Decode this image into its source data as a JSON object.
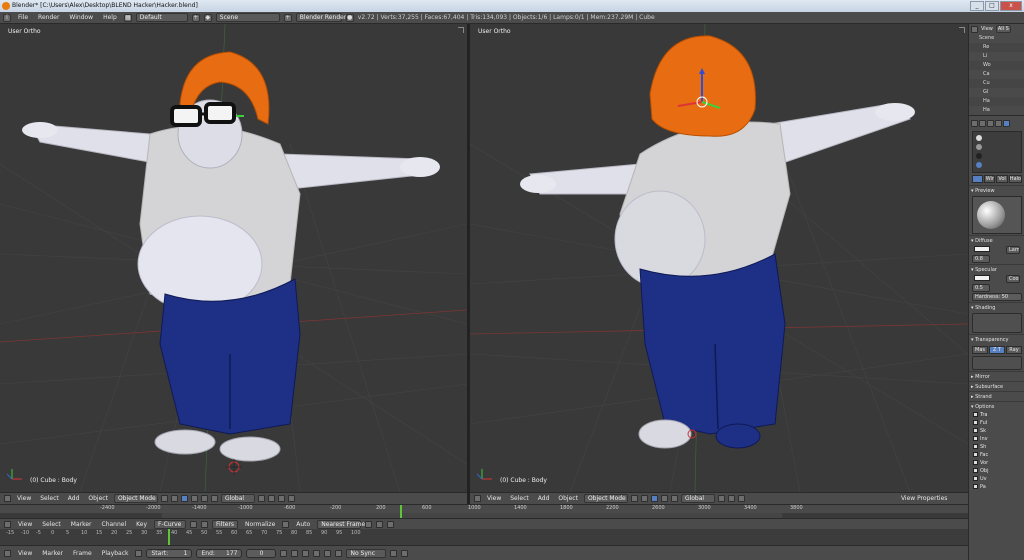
{
  "window": {
    "title": "Blender* [C:\\Users\\Alex\\Desktop\\BLEND Hacker\\Hacker.blend]",
    "controls": [
      "_",
      "□",
      "x"
    ]
  },
  "info_header": {
    "menus": [
      "File",
      "Render",
      "Window",
      "Help"
    ],
    "layout": "Default",
    "scene": "Scene",
    "engine": "Blender Render",
    "stats": "v2.72 | Verts:37,255 | Faces:67,404 | Tris:134,093 | Objects:1/6 | Lamps:0/1 | Mem:237.29M | Cube"
  },
  "viewport_left": {
    "label": "User Ortho",
    "object": "(0) Cube : Body"
  },
  "viewport_right": {
    "label": "User Ortho",
    "object": "(0) Cube : Body"
  },
  "view3d_header_left": {
    "menus": [
      "View",
      "Select",
      "Add",
      "Object"
    ],
    "mode": "Object Mode",
    "orientation": "Global"
  },
  "view3d_header_right": {
    "menus": [
      "View",
      "Select",
      "Add",
      "Object"
    ],
    "mode": "Object Mode",
    "orientation": "Global",
    "extra": "View Properties"
  },
  "timeline": {
    "numbers": [
      "-2400",
      "-2000",
      "-1400",
      "-1000",
      "-600",
      "-200",
      "200",
      "600",
      "1000",
      "1400",
      "1800",
      "2200",
      "2600",
      "3000",
      "3400",
      "3800"
    ],
    "current": "0"
  },
  "graph_header": {
    "menus": [
      "View",
      "Select",
      "Marker",
      "Channel",
      "Key"
    ],
    "mode": "F-Curve",
    "filters": "Filters",
    "normalize": "Normalize",
    "auto": "Auto",
    "snap": "Nearest Frame"
  },
  "graph_numbers": [
    "-15",
    "-10",
    "-5",
    "0",
    "5",
    "10",
    "15",
    "20",
    "25",
    "30",
    "35",
    "40",
    "45",
    "50",
    "55",
    "60",
    "65",
    "70",
    "75",
    "80",
    "85",
    "90",
    "95",
    "100"
  ],
  "bottom_header": {
    "menus": [
      "View",
      "Marker",
      "Frame",
      "Playback"
    ],
    "start": "Start:",
    "start_val": "1",
    "end": "End:",
    "end_val": "177",
    "current": "0",
    "sync": "No Sync"
  },
  "outliner": {
    "header": "View",
    "search": "All S",
    "rows": [
      "Scene",
      "Re",
      "Li",
      "Wo",
      "Ca",
      "Cu",
      "Gl",
      "Ha",
      "Ha"
    ]
  },
  "properties": {
    "material_tabs": [
      "Wir",
      "Vol",
      "Halo"
    ],
    "sections": [
      {
        "name": "Preview",
        "state": "open"
      },
      {
        "name": "Diffuse",
        "state": "open"
      },
      {
        "name": "Specular",
        "state": "open"
      },
      {
        "name": "Shading",
        "state": "open"
      },
      {
        "name": "Transparency",
        "state": "open"
      },
      {
        "name": "Mirror",
        "state": "closed"
      },
      {
        "name": "Subsurface",
        "state": "closed"
      },
      {
        "name": "Strand",
        "state": "closed"
      },
      {
        "name": "Options",
        "state": "open"
      }
    ],
    "diffuse_shader": "Lam",
    "diffuse_intensity": "0.8",
    "specular_shader": "Cook",
    "specular_intensity": "0.5",
    "hardness": "Hardness: 50",
    "trans_tabs": [
      "Mas",
      "Z T",
      "Ray"
    ],
    "options_rows": [
      "Tra",
      "Ful",
      "Sk",
      "Inv",
      "Sh",
      "Fac",
      "Vor",
      "Obj",
      "Uv",
      "Pa"
    ]
  },
  "colors": {
    "shirt": "#d6d6d6",
    "pants": "#1e2f86",
    "hair": "#e86c12",
    "skin": "#dedfe8",
    "accent": "#5680c2",
    "playhead": "#5fc437"
  }
}
